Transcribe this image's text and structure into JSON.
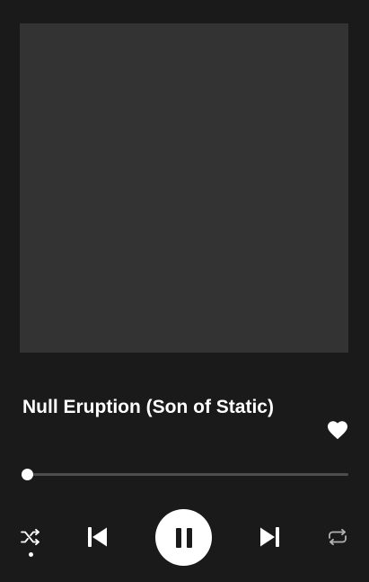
{
  "now_playing": {
    "title": "Null Eruption (Son of Static)",
    "liked": true,
    "progress_fraction": 0.0
  },
  "icons": {
    "like": "heart-icon",
    "shuffle": "shuffle-icon",
    "previous": "skip-previous-icon",
    "play_pause": "pause-icon",
    "next": "skip-next-icon",
    "repeat": "repeat-icon"
  },
  "controls": {
    "shuffle_active": true,
    "repeat_active": false,
    "is_playing": true
  },
  "colors": {
    "background": "#1a1a1a",
    "artwork_placeholder": "#333333",
    "foreground": "#ffffff",
    "track_inactive": "#4d4d4d",
    "icon_inactive": "#b3b3b3"
  }
}
